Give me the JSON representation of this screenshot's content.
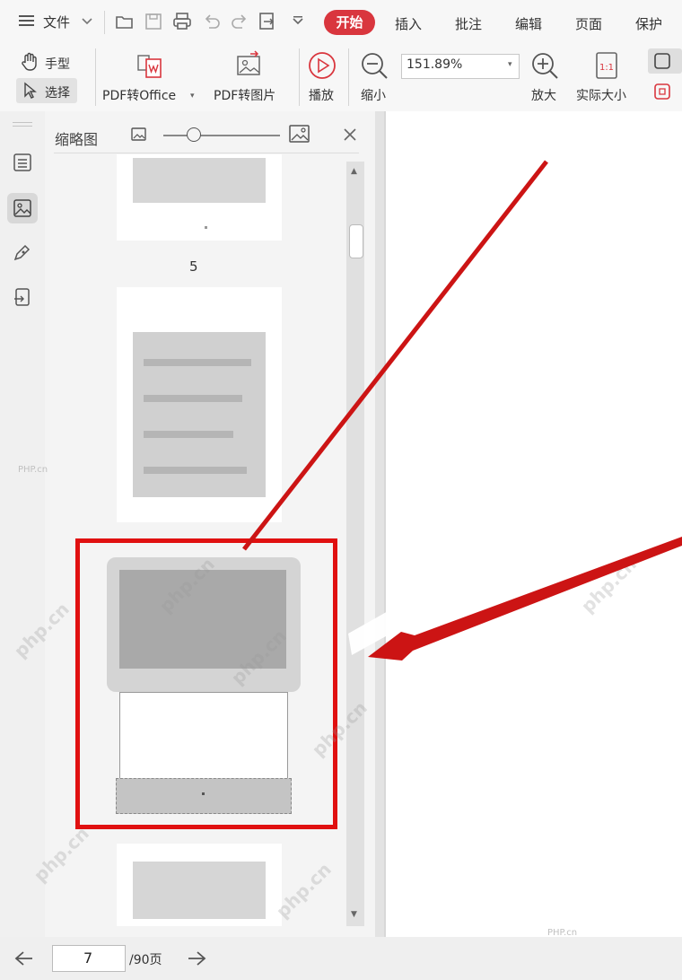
{
  "menubar": {
    "file_label": "文件",
    "tabs": [
      {
        "label": "开始",
        "active": true
      },
      {
        "label": "插入",
        "active": false
      },
      {
        "label": "批注",
        "active": false
      },
      {
        "label": "编辑",
        "active": false
      },
      {
        "label": "页面",
        "active": false
      },
      {
        "label": "保护",
        "active": false
      }
    ]
  },
  "ribbon": {
    "hand_label": "手型",
    "select_label": "选择",
    "pdf_to_office": "PDF转Office",
    "pdf_to_image": "PDF转图片",
    "play": "播放",
    "zoom_out": "缩小",
    "zoom_value": "151.89%",
    "zoom_in": "放大",
    "actual_size": "实际大小"
  },
  "thumbnail_panel": {
    "title": "缩略图",
    "page_number_label": "5"
  },
  "statusbar": {
    "current_page": "7",
    "total_pages": "/90页"
  },
  "watermarks": {
    "small": "PHP.cn",
    "diag": "php.cn"
  },
  "colors": {
    "accent": "#d9363e",
    "highlight_box": "#e01010",
    "arrow": "#cc1414"
  }
}
